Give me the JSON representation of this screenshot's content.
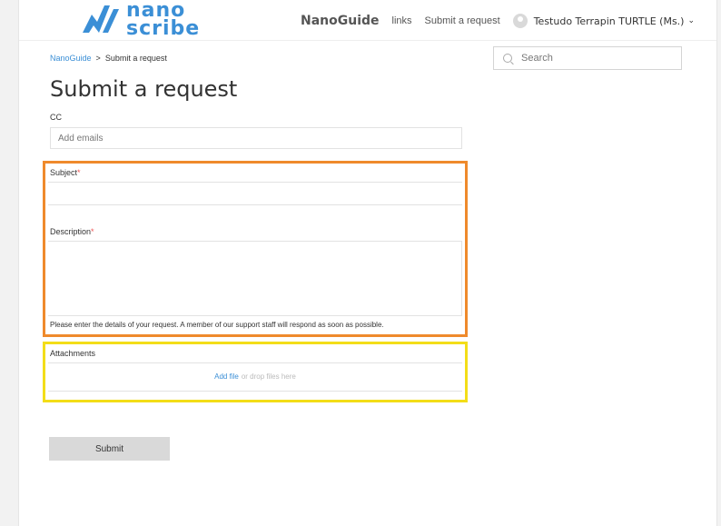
{
  "header": {
    "logo_text": [
      "nano",
      "scribe"
    ],
    "brand": "NanoGuide",
    "links_label": "links",
    "submit_request_label": "Submit a request",
    "user_name": "Testudo Terrapin TURTLE (Ms.)",
    "accent_color": "#3b8fd6"
  },
  "breadcrumb": {
    "home": "NanoGuide",
    "separator": ">",
    "current": "Submit a request"
  },
  "search": {
    "placeholder": "Search"
  },
  "page_title": "Submit a request",
  "form": {
    "cc_label": "CC",
    "cc_placeholder": "Add emails",
    "subject_label": "Subject",
    "description_label": "Description",
    "required_mark": "*",
    "description_hint": "Please enter the details of your request. A member of our support staff will respond as soon as possible.",
    "attachments_label": "Attachments",
    "add_file_label": "Add file",
    "drop_hint": "or drop files here",
    "submit_label": "Submit"
  },
  "highlights": {
    "orange": "#ef8a2c",
    "yellow": "#f3dd18"
  }
}
